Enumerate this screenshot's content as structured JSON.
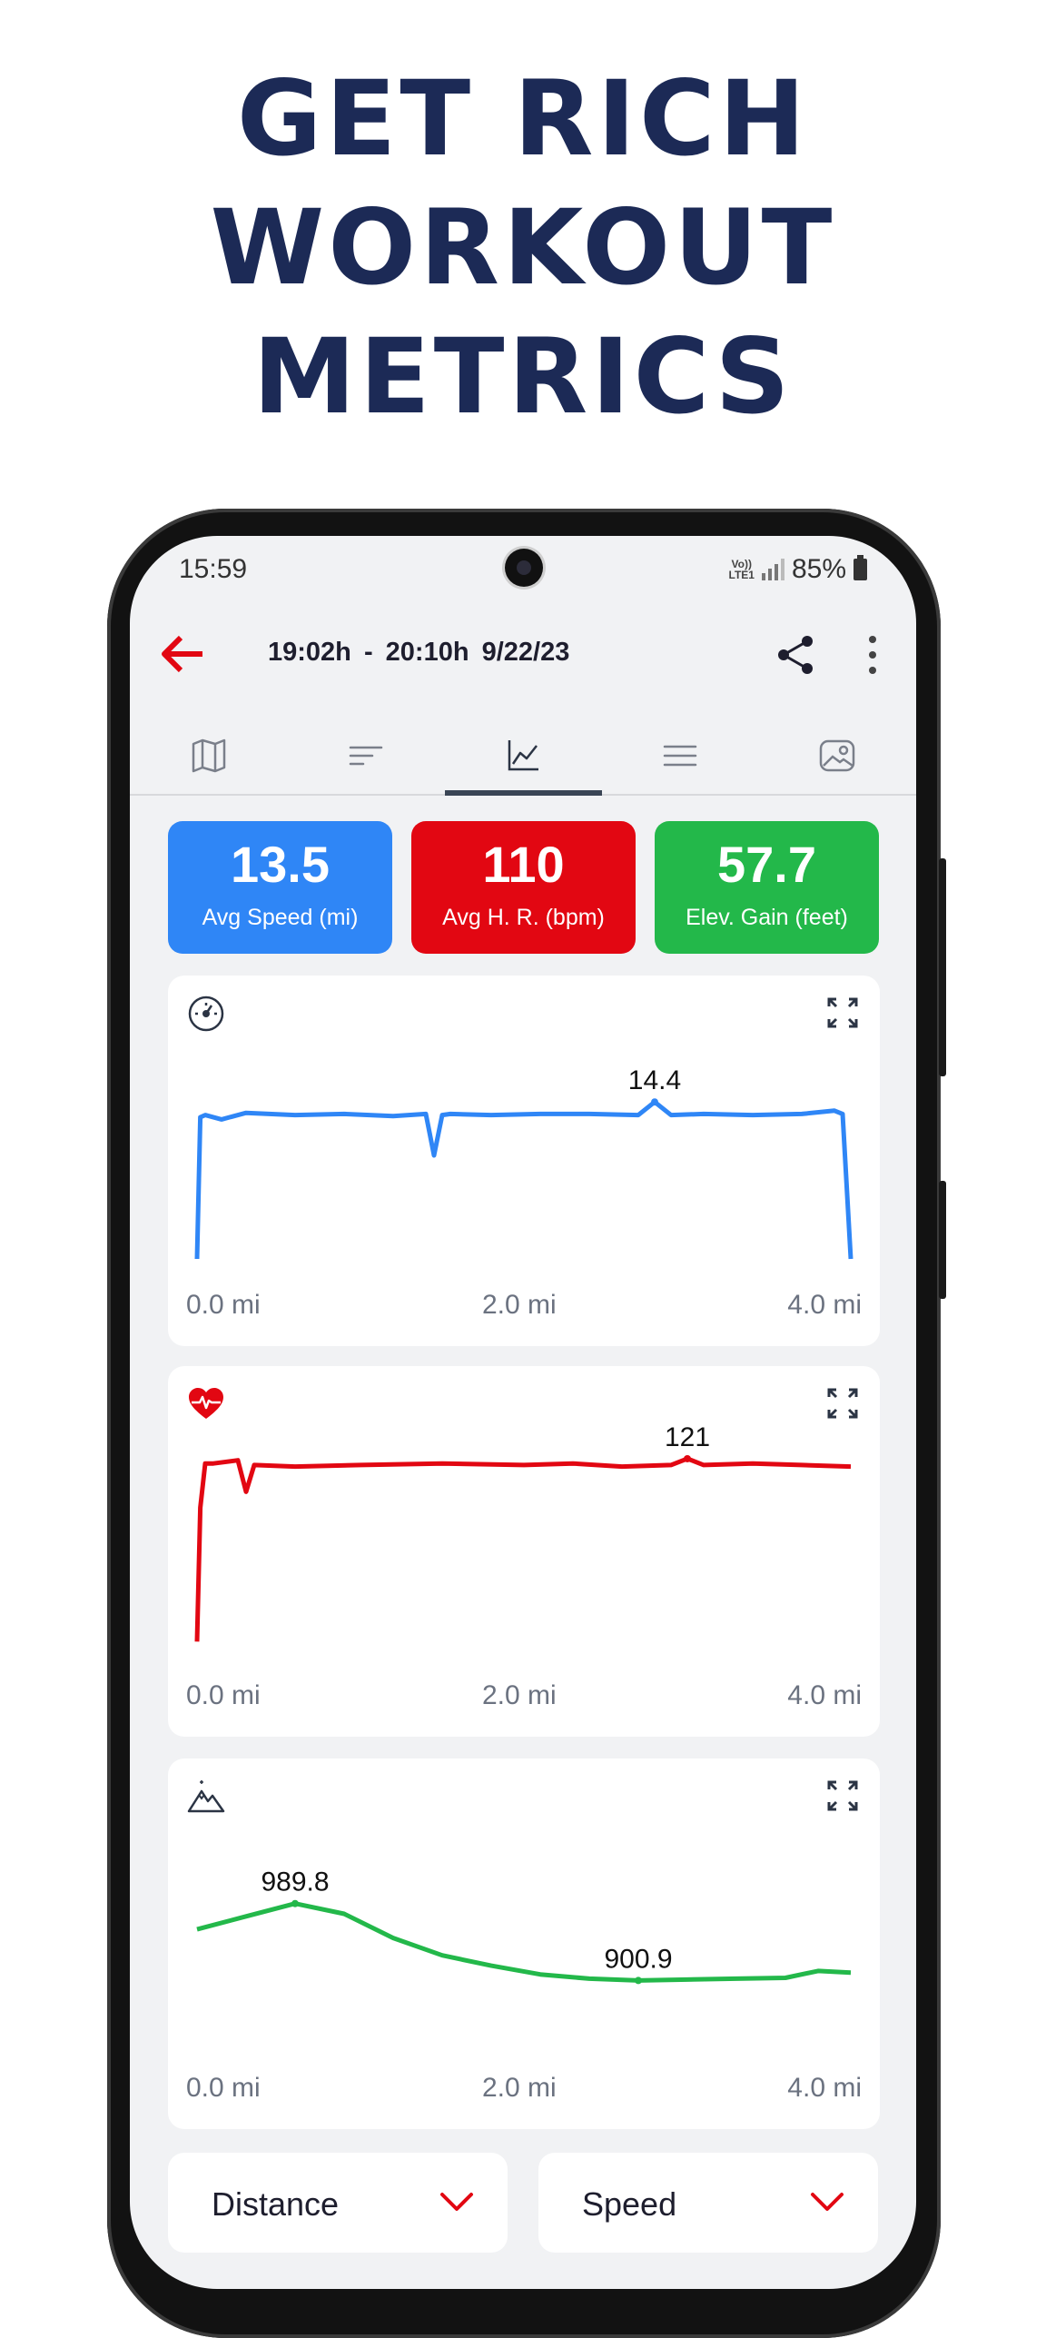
{
  "headline": [
    "GET RICH",
    "WORKOUT",
    "METRICS"
  ],
  "status_bar": {
    "time": "15:59",
    "network": "Vo)) LTE1",
    "battery": "85%"
  },
  "appbar": {
    "title": "19:02h - 20:10h   9/22/23"
  },
  "tabs": [
    {
      "name": "map-tab-icon"
    },
    {
      "name": "laps-tab-icon"
    },
    {
      "name": "charts-tab-icon",
      "active": true
    },
    {
      "name": "details-tab-icon"
    },
    {
      "name": "photos-tab-icon"
    }
  ],
  "stats": [
    {
      "value": "13.5",
      "label": "Avg Speed (mi)",
      "color": "#2f86f6"
    },
    {
      "value": "110",
      "label": "Avg H. R. (bpm)",
      "color": "#e20712"
    },
    {
      "value": "57.7",
      "label": "Elev. Gain (feet)",
      "color": "#23b84a"
    }
  ],
  "charts": {
    "speed": {
      "max_label": "14.4",
      "x_ticks": [
        "0.0 mi",
        "2.0 mi",
        "4.0 mi"
      ],
      "color": "#2f86f6"
    },
    "heart_rate": {
      "max_label": "121",
      "x_ticks": [
        "0.0 mi",
        "2.0 mi",
        "4.0 mi"
      ],
      "color": "#e20712"
    },
    "elevation": {
      "max_label": "989.8",
      "min_label": "900.9",
      "x_ticks": [
        "0.0 mi",
        "2.0 mi",
        "4.0 mi"
      ],
      "color": "#23b84a"
    }
  },
  "chart_data": [
    {
      "type": "line",
      "x_unit": "mi",
      "x": [
        0.0,
        0.02,
        0.05,
        0.15,
        0.3,
        0.6,
        0.9,
        1.2,
        1.4,
        1.45,
        1.5,
        1.55,
        1.8,
        2.1,
        2.4,
        2.7,
        2.8,
        2.9,
        3.1,
        3.4,
        3.7,
        3.9,
        3.95,
        4.0
      ],
      "y": [
        0.0,
        13.0,
        13.2,
        12.8,
        13.4,
        13.2,
        13.3,
        13.1,
        13.3,
        9.5,
        13.2,
        13.3,
        13.2,
        13.3,
        13.3,
        13.2,
        14.4,
        13.2,
        13.3,
        13.2,
        13.3,
        13.6,
        13.3,
        0.0
      ],
      "annotations": [
        "14.4"
      ],
      "xlim": [
        0,
        4.0
      ]
    },
    {
      "type": "line",
      "x_unit": "mi",
      "x": [
        0.0,
        0.02,
        0.05,
        0.1,
        0.25,
        0.3,
        0.35,
        0.6,
        1.0,
        1.5,
        2.0,
        2.3,
        2.6,
        2.9,
        3.0,
        3.1,
        3.4,
        3.7,
        4.0
      ],
      "y": [
        5,
        90,
        118,
        118,
        120,
        100,
        117,
        116,
        117,
        118,
        117,
        118,
        116,
        117,
        121,
        117,
        118,
        117,
        116
      ],
      "annotations": [
        "121"
      ],
      "xlim": [
        0,
        4.0
      ]
    },
    {
      "type": "line",
      "x_unit": "mi",
      "x": [
        0.0,
        0.3,
        0.6,
        0.9,
        1.2,
        1.5,
        1.8,
        2.1,
        2.4,
        2.7,
        3.0,
        3.3,
        3.6,
        3.8,
        4.0
      ],
      "y": [
        960,
        975,
        989.8,
        978,
        950,
        930,
        918,
        908,
        903,
        900.9,
        902,
        903,
        904,
        912,
        910
      ],
      "annotations": [
        "989.8",
        "900.9"
      ],
      "xlim": [
        0,
        4.0
      ]
    }
  ],
  "dropdowns": [
    {
      "label": "Distance"
    },
    {
      "label": "Speed"
    }
  ],
  "accent_color": "#e20712"
}
